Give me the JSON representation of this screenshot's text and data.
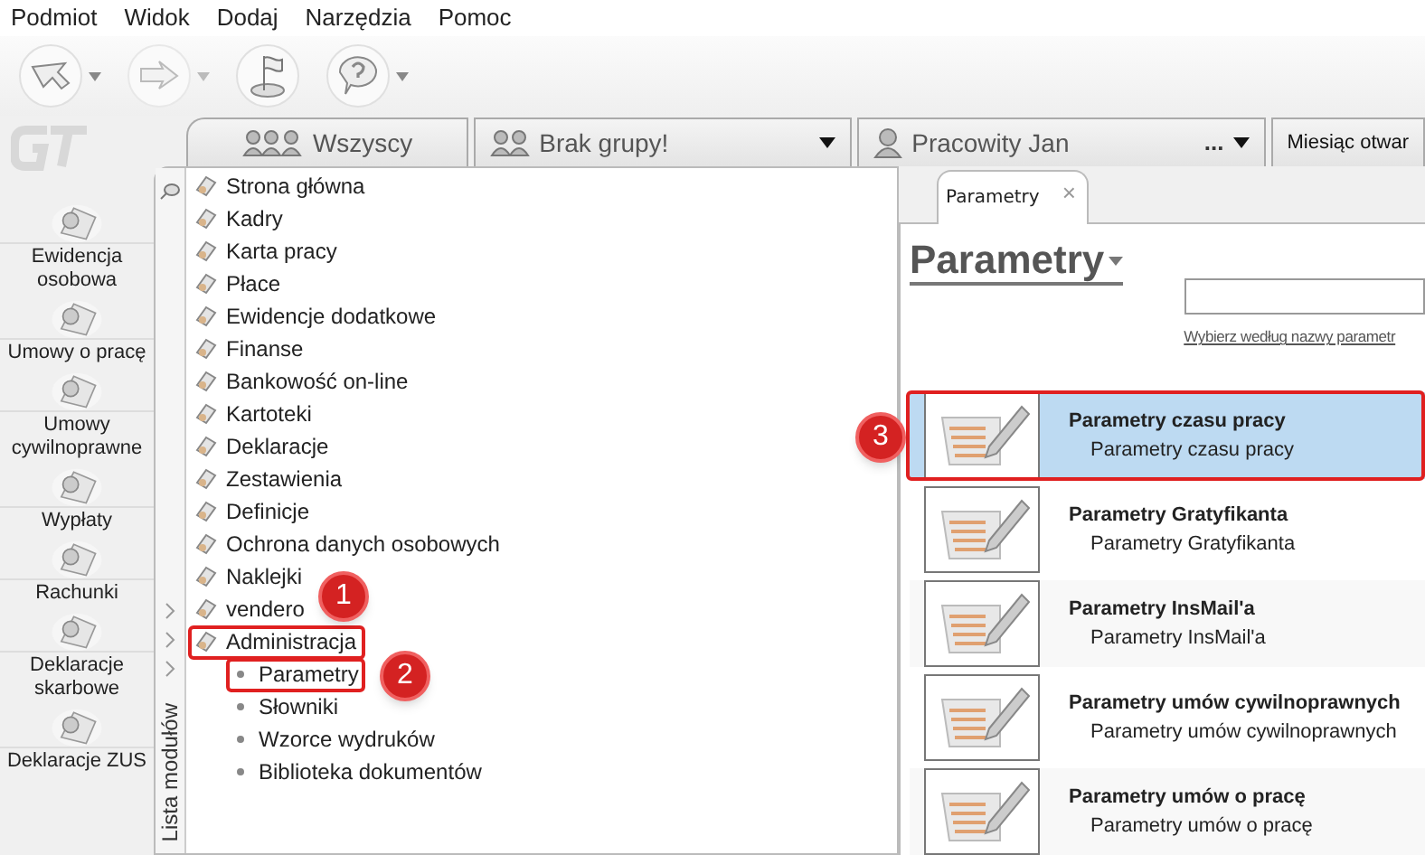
{
  "menu": [
    "Podmiot",
    "Widok",
    "Dodaj",
    "Narzędzia",
    "Pomoc"
  ],
  "nav": [
    "Ewidencja osobowa",
    "Umowy o pracę",
    "Umowy cywilnoprawne",
    "Wypłaty",
    "Rachunki",
    "Deklaracje skarbowe",
    "Deklaracje ZUS"
  ],
  "context_tabs": [
    {
      "kind": "group",
      "label": "Wszyscy"
    },
    {
      "kind": "group",
      "label": "Brak grupy!",
      "dropdown": true
    },
    {
      "kind": "person",
      "label": "Pracowity Jan",
      "more": "...",
      "dropdown": true
    },
    {
      "kind": "plain",
      "label": "Miesiąc otwar"
    }
  ],
  "modules_title": "Lista modułów",
  "modules": [
    {
      "label": "Strona główna"
    },
    {
      "label": "Kadry"
    },
    {
      "label": "Karta pracy"
    },
    {
      "label": "Płace"
    },
    {
      "label": "Ewidencje dodatkowe"
    },
    {
      "label": "Finanse"
    },
    {
      "label": "Bankowość on-line"
    },
    {
      "label": "Kartoteki"
    },
    {
      "label": "Deklaracje"
    },
    {
      "label": "Zestawienia"
    },
    {
      "label": "Definicje"
    },
    {
      "label": "Ochrona danych osobowych"
    },
    {
      "label": "Naklejki"
    },
    {
      "label": "vendero"
    },
    {
      "label": "Administracja",
      "expanded": true,
      "children": [
        {
          "label": "Parametry"
        },
        {
          "label": "Słowniki"
        },
        {
          "label": "Wzorce wydruków"
        },
        {
          "label": "Biblioteka dokumentów"
        }
      ]
    }
  ],
  "doc_tab": {
    "label": "Parametry",
    "close": "×"
  },
  "heading": "Parametry",
  "search_hint": "Wybierz według nazwy parametr",
  "items": [
    {
      "title": "Parametry czasu pracy",
      "subtitle": "Parametry czasu pracy",
      "selected": true
    },
    {
      "title": "Parametry Gratyfikanta",
      "subtitle": "Parametry Gratyfikanta",
      "selected": false
    },
    {
      "title": "Parametry InsMail'a",
      "subtitle": "Parametry InsMail'a",
      "selected": false
    },
    {
      "title": "Parametry umów cywilnoprawnych",
      "subtitle": "Parametry umów cywilnoprawnych",
      "selected": false
    },
    {
      "title": "Parametry umów o pracę",
      "subtitle": "Parametry umów o pracę",
      "selected": false
    }
  ],
  "callouts": [
    "1",
    "2",
    "3"
  ]
}
